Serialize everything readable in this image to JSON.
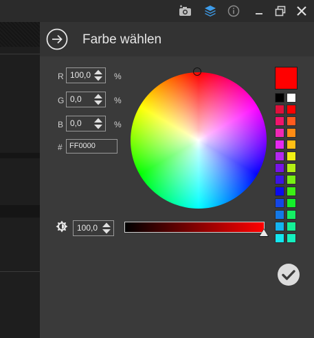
{
  "window": {
    "icons": [
      "camera-icon",
      "layers-icon",
      "info-icon",
      "minimize-icon",
      "restore-icon",
      "close-icon"
    ],
    "layers_color": "#3d9be9"
  },
  "dialog": {
    "title": "Farbe wählen",
    "back_icon": "arrow-right-circle-icon",
    "channels": [
      {
        "label": "R",
        "value": "100,0",
        "unit": "%"
      },
      {
        "label": "G",
        "value": "0,0",
        "unit": "%"
      },
      {
        "label": "B",
        "value": "0,0",
        "unit": "%"
      }
    ],
    "hex_label": "#",
    "hex_value": "FF0000",
    "brightness_value": "100,0",
    "brightness_level": 1.0,
    "selected_color": "#ff0000",
    "palette": [
      [
        "#000000",
        "#ffffff"
      ],
      [
        "#e0103c",
        "#ff0000"
      ],
      [
        "#f0146c",
        "#ff5a1e"
      ],
      [
        "#f028b4",
        "#ff8c14"
      ],
      [
        "#e628f0",
        "#ffbe14"
      ],
      [
        "#b428f0",
        "#f0f014"
      ],
      [
        "#7814e6",
        "#b4f014"
      ],
      [
        "#3c14e6",
        "#78f014"
      ],
      [
        "#0a0af0",
        "#3cf014"
      ],
      [
        "#1446e6",
        "#14f02a"
      ],
      [
        "#1478e6",
        "#14f064"
      ],
      [
        "#14b4f0",
        "#14f096"
      ],
      [
        "#14e6f0",
        "#14f0be"
      ]
    ],
    "confirm_icon": "checkmark-icon"
  }
}
